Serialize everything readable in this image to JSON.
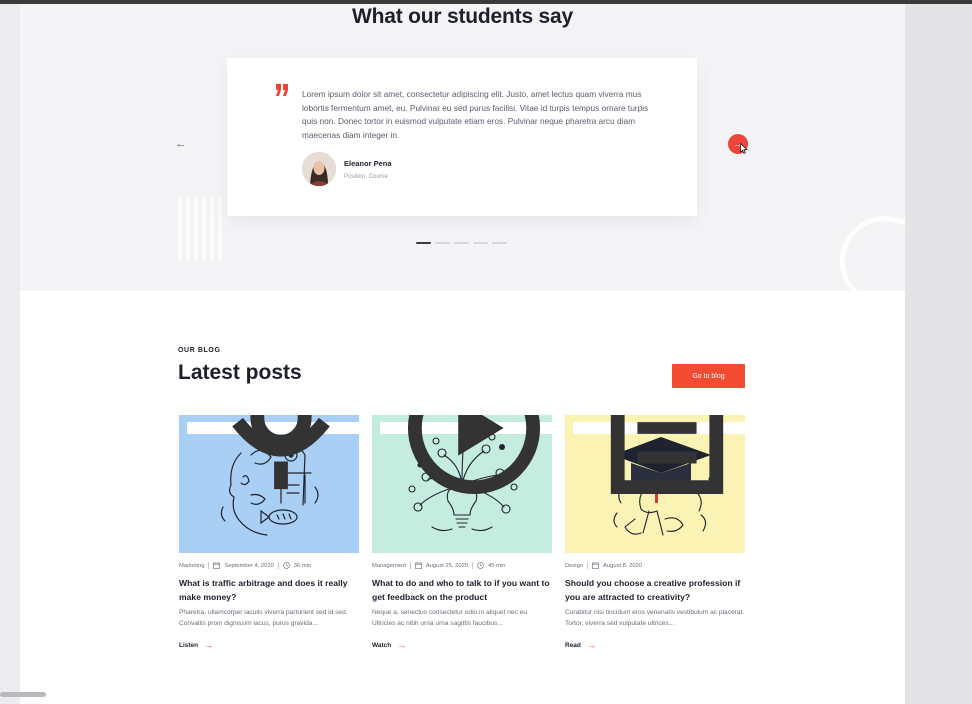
{
  "testimonials": {
    "heading": "What our students say",
    "quote": "Lorem ipsum dolor sit amet, consectetur adipiscing elit. Justo, amet lectus quam viverra mus lobortis fermentum amet, eu. Pulvinar eu sed purus facilisi. Vitae id turpis tempus ornare turpis quis non. Donec tortor in euismod vulputate etiam eros. Pulvinar neque pharetra arcu diam maecenas diam integer in.",
    "author_name": "Eleanor Pena",
    "author_role": "Position, Course",
    "prev_label": "←",
    "next_label": "→",
    "slides": 5,
    "active_slide": 1,
    "accent_color": "#f0443a"
  },
  "blog": {
    "eyebrow": "OUR BLOG",
    "heading": "Latest posts",
    "cta_label": "Go to blog",
    "cta_color": "#f24b32",
    "posts": [
      {
        "type": "Podcast",
        "type_icon": "microphone-icon",
        "category": "Marketing",
        "date": "September 4, 2020",
        "duration": "36 min",
        "title": "What is traffic arbitrage and does it really make money?",
        "excerpt": "Pharetra, ullamcorper iaculis viverra parturient sed id sed. Convallis proin dignissim lacus, purus gravida...",
        "link": "Listen",
        "image_bg": "#a9cff5"
      },
      {
        "type": "Video",
        "type_icon": "play-icon",
        "category": "Management",
        "date": "August 25, 2020",
        "duration": "45 min",
        "title": "What to do and who to talk to if you want to get feedback on the product",
        "excerpt": "Neque a, senectus consectetur odio in aliquet nec eu. Ultricies ac nibh urna urna sagittis faucibus...",
        "link": "Watch",
        "image_bg": "#c5eddf"
      },
      {
        "type": "Article",
        "type_icon": "file-icon",
        "category": "Design",
        "date": "August 8, 2020",
        "duration": "",
        "title": "Should you choose a creative profession if you are attracted to creativity?",
        "excerpt": "Curabitur nisi tincidunt eros venenatis vestibulum ac placerat. Tortor, viverra sed vulputate ultrices...",
        "link": "Read",
        "image_bg": "#fbf3b3"
      }
    ]
  }
}
